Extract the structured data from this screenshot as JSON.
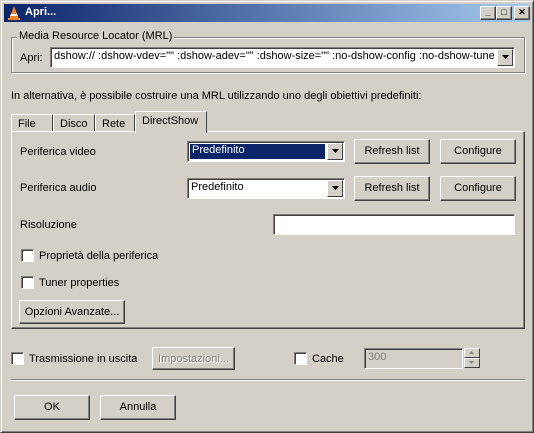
{
  "window": {
    "title": "Apri..."
  },
  "titlebar_buttons": {
    "minimize": "_",
    "maximize": "□",
    "close": "✕"
  },
  "mrl": {
    "group_label": "Media Resource Locator (MRL)",
    "open_label": "Apri:",
    "value": "dshow:// :dshow-vdev=\"\" :dshow-adev=\"\" :dshow-size=\"\" :no-dshow-config :no-dshow-tuner"
  },
  "hint": "In alternativa, è possibile costruire una MRL utilizzando uno degli obiettivi predefiniti:",
  "tabs": [
    {
      "label": "File"
    },
    {
      "label": "Disco"
    },
    {
      "label": "Rete"
    },
    {
      "label": "DirectShow"
    }
  ],
  "directshow": {
    "video_label": "Periferica video",
    "video_value": "Predefinito",
    "audio_label": "Periferica audio",
    "audio_value": "Predefinito",
    "refresh_label": "Refresh list",
    "configure_label": "Configure",
    "resolution_label": "Risoluzione",
    "resolution_value": "",
    "device_props_label": "Proprietà della periferica",
    "tuner_props_label": "Tuner properties",
    "advanced_label": "Opzioni Avanzate..."
  },
  "output": {
    "stream_label": "Trasmissione in uscita",
    "settings_label": "Impostazioni...",
    "cache_label": "Cache",
    "cache_value": "300"
  },
  "footer": {
    "ok_label": "OK",
    "cancel_label": "Annulla"
  },
  "colors": {
    "face": "#d4d0c8",
    "selection": "#0a246a",
    "titlebar_start": "#0a246a",
    "titlebar_end": "#a6caf0"
  }
}
